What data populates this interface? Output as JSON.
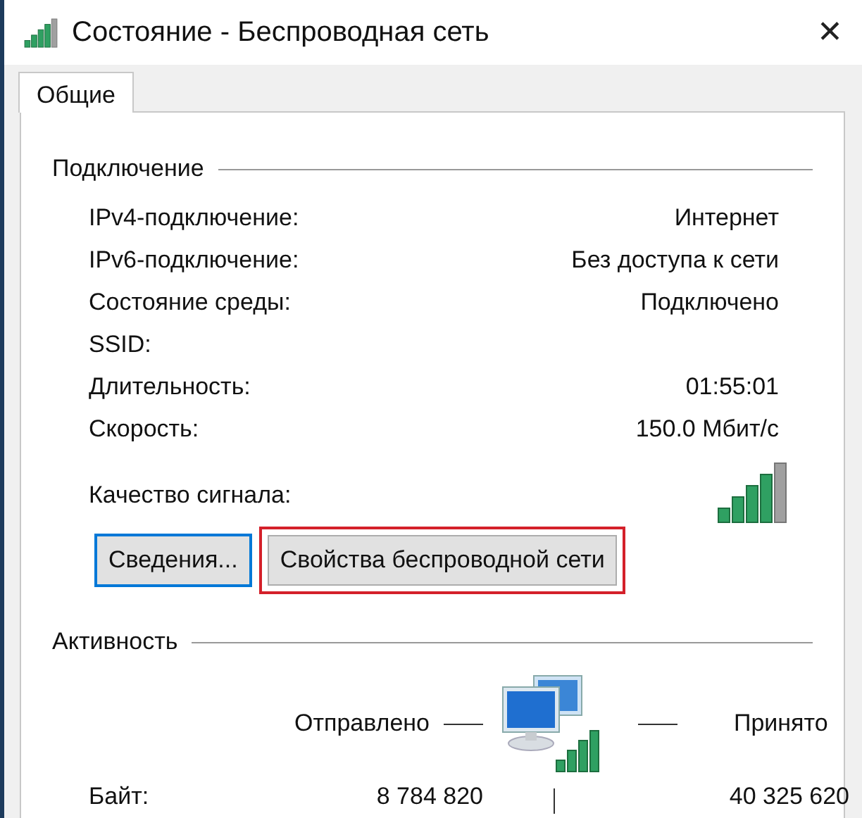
{
  "window": {
    "title": "Состояние - Беспроводная сеть",
    "close": "✕"
  },
  "tabs": [
    {
      "label": "Общие",
      "selected": true
    }
  ],
  "connection": {
    "heading": "Подключение",
    "rows": [
      {
        "label": "IPv4-подключение:",
        "value": "Интернет"
      },
      {
        "label": "IPv6-подключение:",
        "value": "Без доступа к сети"
      },
      {
        "label": "Состояние среды:",
        "value": "Подключено"
      },
      {
        "label": "SSID:"
      },
      {
        "label": "Длительность:",
        "value": "01:55:01"
      },
      {
        "label": "Скорость:",
        "value": "150.0 Мбит/с"
      }
    ],
    "signal_label": "Качество сигнала:"
  },
  "buttons": [
    {
      "label": "Сведения...",
      "focused": true,
      "highlighted": false
    },
    {
      "label": "Свойства беспроводной сети",
      "focused": false,
      "highlighted": true
    }
  ],
  "activity": {
    "heading": "Активность",
    "sent_label": "Отправлено",
    "received_label": "Принято",
    "bytes_label": "Байт:",
    "bytes_sent": "8 784 820",
    "bytes_received": "40 325 620"
  }
}
